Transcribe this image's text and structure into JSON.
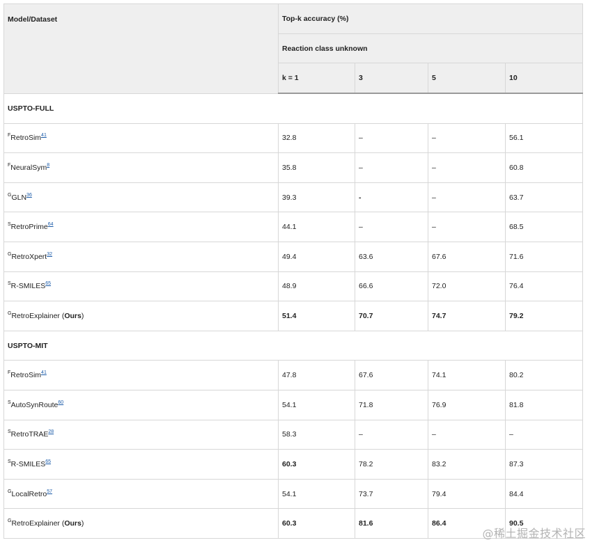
{
  "header": {
    "model_dataset": "Model/Dataset",
    "topk": "Top-k accuracy (%)",
    "condition": "Reaction class unknown",
    "k_values": [
      "k = 1",
      "3",
      "5",
      "10"
    ]
  },
  "sections": [
    {
      "title": "USPTO-FULL",
      "rows": [
        {
          "prefix": "F",
          "name": "RetroSim",
          "ref": "41",
          "ours": "",
          "bold_name": false,
          "values": [
            "32.8",
            "–",
            "–",
            "56.1"
          ],
          "bold": [
            false,
            false,
            false,
            false
          ]
        },
        {
          "prefix": "F",
          "name": "NeuralSym",
          "ref": "8",
          "ours": "",
          "bold_name": false,
          "values": [
            "35.8",
            "–",
            "–",
            "60.8"
          ],
          "bold": [
            false,
            false,
            false,
            false
          ]
        },
        {
          "prefix": "G",
          "name": "GLN",
          "ref": "36",
          "ours": "",
          "bold_name": false,
          "values": [
            "39.3",
            "-",
            "–",
            "63.7"
          ],
          "bold": [
            false,
            true,
            false,
            false
          ]
        },
        {
          "prefix": "S",
          "name": "RetroPrime",
          "ref": "64",
          "ours": "",
          "bold_name": false,
          "values": [
            "44.1",
            "–",
            "–",
            "68.5"
          ],
          "bold": [
            false,
            false,
            false,
            false
          ]
        },
        {
          "prefix": "G",
          "name": "RetroXpert",
          "ref": "32",
          "ours": "",
          "bold_name": false,
          "values": [
            "49.4",
            "63.6",
            "67.6",
            "71.6"
          ],
          "bold": [
            false,
            false,
            false,
            false
          ]
        },
        {
          "prefix": "S",
          "name": "R-SMILES",
          "ref": "65",
          "ours": "",
          "bold_name": false,
          "values": [
            "48.9",
            "66.6",
            "72.0",
            "76.4"
          ],
          "bold": [
            false,
            false,
            false,
            false
          ]
        },
        {
          "prefix": "G",
          "name": "RetroExplainer (",
          "ref": "",
          "ours": "Ours",
          "bold_name": false,
          "values": [
            "51.4",
            "70.7",
            "74.7",
            "79.2"
          ],
          "bold": [
            true,
            true,
            true,
            true
          ]
        }
      ]
    },
    {
      "title": "USPTO-MIT",
      "rows": [
        {
          "prefix": "F",
          "name": "RetroSim",
          "ref": "41",
          "ours": "",
          "bold_name": false,
          "values": [
            "47.8",
            "67.6",
            "74.1",
            "80.2"
          ],
          "bold": [
            false,
            false,
            false,
            false
          ]
        },
        {
          "prefix": "S",
          "name": "AutoSynRoute",
          "ref": "60",
          "ours": "",
          "bold_name": false,
          "values": [
            "54.1",
            "71.8",
            "76.9",
            "81.8"
          ],
          "bold": [
            false,
            false,
            false,
            false
          ]
        },
        {
          "prefix": "S",
          "name": "RetroTRAE",
          "ref": "28",
          "ours": "",
          "bold_name": false,
          "values": [
            "58.3",
            "–",
            "–",
            "–"
          ],
          "bold": [
            false,
            false,
            false,
            false
          ]
        },
        {
          "prefix": "S",
          "name": "R-SMILES",
          "ref": "65",
          "ours": "",
          "bold_name": false,
          "values": [
            "60.3",
            "78.2",
            "83.2",
            "87.3"
          ],
          "bold": [
            true,
            false,
            false,
            false
          ]
        },
        {
          "prefix": "G",
          "name": "LocalRetro",
          "ref": "57",
          "ours": "",
          "bold_name": false,
          "values": [
            "54.1",
            "73.7",
            "79.4",
            "84.4"
          ],
          "bold": [
            false,
            false,
            false,
            false
          ]
        },
        {
          "prefix": "G",
          "name": "RetroExplainer (",
          "ref": "",
          "ours": "Ours",
          "bold_name": false,
          "values": [
            "60.3",
            "81.6",
            "86.4",
            "90.5"
          ],
          "bold": [
            true,
            true,
            true,
            true
          ]
        }
      ]
    }
  ],
  "watermark": "@稀土掘金技术社区"
}
